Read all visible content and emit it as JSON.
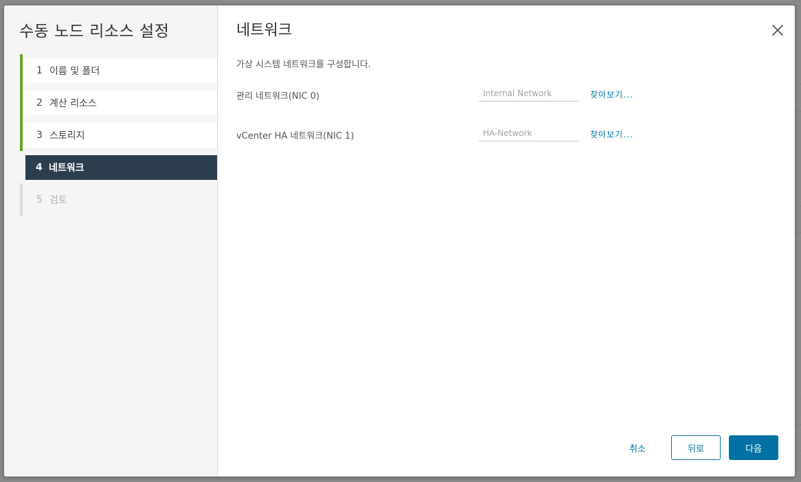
{
  "sidebar": {
    "title": "수동 노드 리소스 설정",
    "steps": [
      {
        "num": "1",
        "label": "이름 및 폴더",
        "state": "done"
      },
      {
        "num": "2",
        "label": "계산 리소스",
        "state": "done"
      },
      {
        "num": "3",
        "label": "스토리지",
        "state": "done"
      },
      {
        "num": "4",
        "label": "네트워크",
        "state": "active"
      },
      {
        "num": "5",
        "label": "검토",
        "state": "pending"
      }
    ]
  },
  "main": {
    "title": "네트워크",
    "description": "가상 시스템 네트워크를 구성합니다.",
    "rows": [
      {
        "label": "관리 네트워크(NIC 0)",
        "placeholder": "Internal Network",
        "browse_label": "찾아보기..."
      },
      {
        "label": "vCenter HA 네트워크(NIC 1)",
        "placeholder": "HA-Network",
        "browse_label": "찾아보기..."
      }
    ]
  },
  "footer": {
    "cancel_label": "취소",
    "back_label": "뒤로",
    "next_label": "다음"
  },
  "icons": {
    "close": "close-icon"
  },
  "colors": {
    "accent": "#0072a3",
    "done": "#62a420",
    "active_step_bg": "#2c3e4e"
  }
}
